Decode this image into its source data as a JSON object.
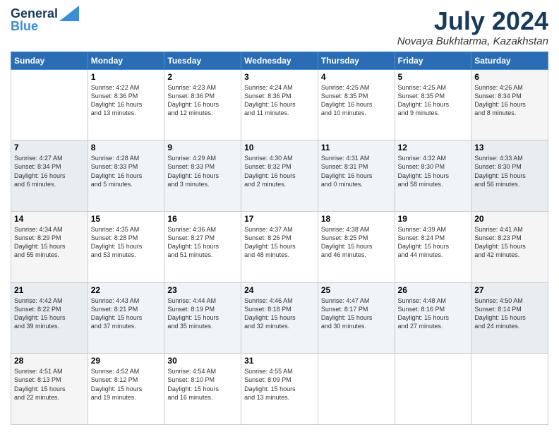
{
  "header": {
    "logo_line1": "General",
    "logo_line2": "Blue",
    "month_title": "July 2024",
    "location": "Novaya Bukhtarma, Kazakhstan"
  },
  "weekdays": [
    "Sunday",
    "Monday",
    "Tuesday",
    "Wednesday",
    "Thursday",
    "Friday",
    "Saturday"
  ],
  "weeks": [
    [
      {
        "day": "",
        "info": ""
      },
      {
        "day": "1",
        "info": "Sunrise: 4:22 AM\nSunset: 8:36 PM\nDaylight: 16 hours\nand 13 minutes."
      },
      {
        "day": "2",
        "info": "Sunrise: 4:23 AM\nSunset: 8:36 PM\nDaylight: 16 hours\nand 12 minutes."
      },
      {
        "day": "3",
        "info": "Sunrise: 4:24 AM\nSunset: 8:36 PM\nDaylight: 16 hours\nand 11 minutes."
      },
      {
        "day": "4",
        "info": "Sunrise: 4:25 AM\nSunset: 8:35 PM\nDaylight: 16 hours\nand 10 minutes."
      },
      {
        "day": "5",
        "info": "Sunrise: 4:25 AM\nSunset: 8:35 PM\nDaylight: 16 hours\nand 9 minutes."
      },
      {
        "day": "6",
        "info": "Sunrise: 4:26 AM\nSunset: 8:34 PM\nDaylight: 16 hours\nand 8 minutes."
      }
    ],
    [
      {
        "day": "7",
        "info": "Sunrise: 4:27 AM\nSunset: 8:34 PM\nDaylight: 16 hours\nand 6 minutes."
      },
      {
        "day": "8",
        "info": "Sunrise: 4:28 AM\nSunset: 8:33 PM\nDaylight: 16 hours\nand 5 minutes."
      },
      {
        "day": "9",
        "info": "Sunrise: 4:29 AM\nSunset: 8:33 PM\nDaylight: 16 hours\nand 3 minutes."
      },
      {
        "day": "10",
        "info": "Sunrise: 4:30 AM\nSunset: 8:32 PM\nDaylight: 16 hours\nand 2 minutes."
      },
      {
        "day": "11",
        "info": "Sunrise: 4:31 AM\nSunset: 8:31 PM\nDaylight: 16 hours\nand 0 minutes."
      },
      {
        "day": "12",
        "info": "Sunrise: 4:32 AM\nSunset: 8:30 PM\nDaylight: 15 hours\nand 58 minutes."
      },
      {
        "day": "13",
        "info": "Sunrise: 4:33 AM\nSunset: 8:30 PM\nDaylight: 15 hours\nand 56 minutes."
      }
    ],
    [
      {
        "day": "14",
        "info": "Sunrise: 4:34 AM\nSunset: 8:29 PM\nDaylight: 15 hours\nand 55 minutes."
      },
      {
        "day": "15",
        "info": "Sunrise: 4:35 AM\nSunset: 8:28 PM\nDaylight: 15 hours\nand 53 minutes."
      },
      {
        "day": "16",
        "info": "Sunrise: 4:36 AM\nSunset: 8:27 PM\nDaylight: 15 hours\nand 51 minutes."
      },
      {
        "day": "17",
        "info": "Sunrise: 4:37 AM\nSunset: 8:26 PM\nDaylight: 15 hours\nand 48 minutes."
      },
      {
        "day": "18",
        "info": "Sunrise: 4:38 AM\nSunset: 8:25 PM\nDaylight: 15 hours\nand 46 minutes."
      },
      {
        "day": "19",
        "info": "Sunrise: 4:39 AM\nSunset: 8:24 PM\nDaylight: 15 hours\nand 44 minutes."
      },
      {
        "day": "20",
        "info": "Sunrise: 4:41 AM\nSunset: 8:23 PM\nDaylight: 15 hours\nand 42 minutes."
      }
    ],
    [
      {
        "day": "21",
        "info": "Sunrise: 4:42 AM\nSunset: 8:22 PM\nDaylight: 15 hours\nand 39 minutes."
      },
      {
        "day": "22",
        "info": "Sunrise: 4:43 AM\nSunset: 8:21 PM\nDaylight: 15 hours\nand 37 minutes."
      },
      {
        "day": "23",
        "info": "Sunrise: 4:44 AM\nSunset: 8:19 PM\nDaylight: 15 hours\nand 35 minutes."
      },
      {
        "day": "24",
        "info": "Sunrise: 4:46 AM\nSunset: 8:18 PM\nDaylight: 15 hours\nand 32 minutes."
      },
      {
        "day": "25",
        "info": "Sunrise: 4:47 AM\nSunset: 8:17 PM\nDaylight: 15 hours\nand 30 minutes."
      },
      {
        "day": "26",
        "info": "Sunrise: 4:48 AM\nSunset: 8:16 PM\nDaylight: 15 hours\nand 27 minutes."
      },
      {
        "day": "27",
        "info": "Sunrise: 4:50 AM\nSunset: 8:14 PM\nDaylight: 15 hours\nand 24 minutes."
      }
    ],
    [
      {
        "day": "28",
        "info": "Sunrise: 4:51 AM\nSunset: 8:13 PM\nDaylight: 15 hours\nand 22 minutes."
      },
      {
        "day": "29",
        "info": "Sunrise: 4:52 AM\nSunset: 8:12 PM\nDaylight: 15 hours\nand 19 minutes."
      },
      {
        "day": "30",
        "info": "Sunrise: 4:54 AM\nSunset: 8:10 PM\nDaylight: 15 hours\nand 16 minutes."
      },
      {
        "day": "31",
        "info": "Sunrise: 4:55 AM\nSunset: 8:09 PM\nDaylight: 15 hours\nand 13 minutes."
      },
      {
        "day": "",
        "info": ""
      },
      {
        "day": "",
        "info": ""
      },
      {
        "day": "",
        "info": ""
      }
    ]
  ]
}
